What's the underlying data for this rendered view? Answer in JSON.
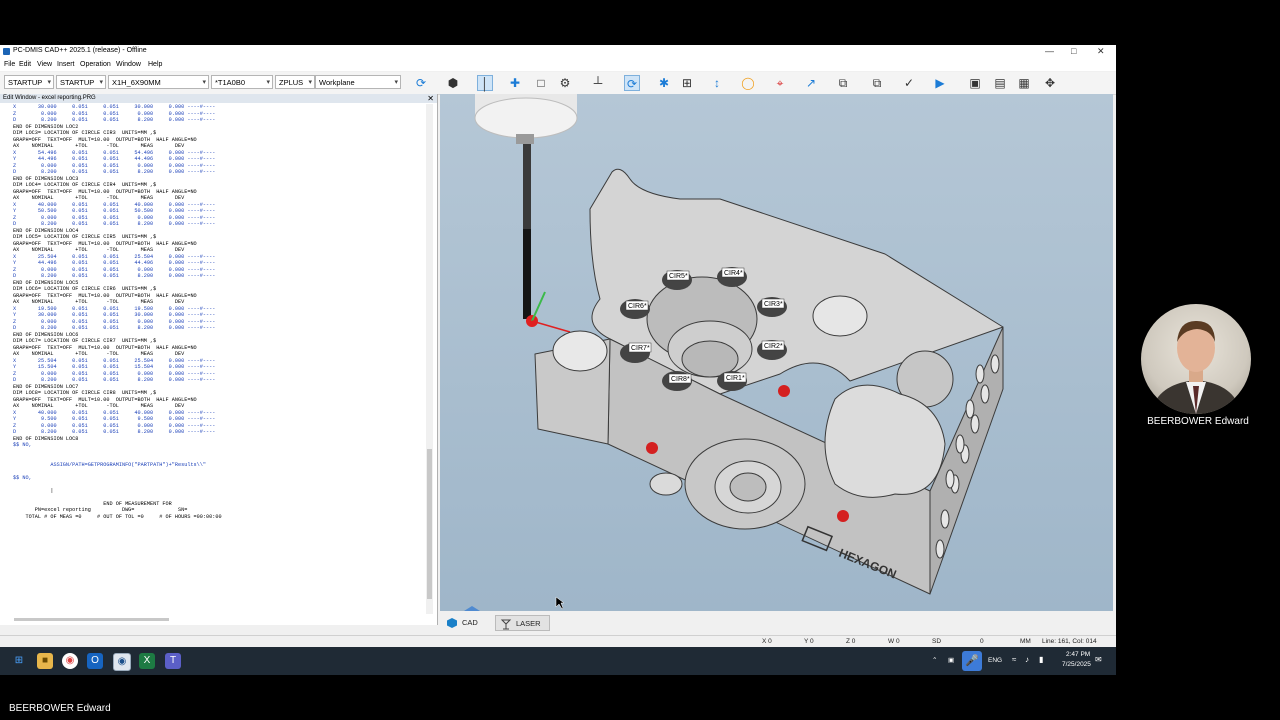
{
  "window": {
    "title": "PC-DMIS CAD++ 2025.1 (release) - Offline",
    "controls": [
      "—",
      "□",
      "✕"
    ]
  },
  "menu": [
    "File",
    "Edit",
    "View",
    "Insert",
    "Operation",
    "Window",
    "Help"
  ],
  "toolbar": {
    "combos": [
      {
        "name": "probe-file-combo",
        "value": "STARTUP"
      },
      {
        "name": "probe-alignment-combo",
        "value": "STARTUP"
      },
      {
        "name": "probe-model-combo",
        "value": "X1H_6X90MM"
      },
      {
        "name": "tip-combo",
        "value": "*T1A0B0"
      },
      {
        "name": "view-dir-combo",
        "value": "ZPLUS"
      },
      {
        "name": "workplane-combo",
        "value": "Workplane"
      }
    ]
  },
  "edit_window": {
    "title": "Edit Window - excel reporting.PRG",
    "close": "✕",
    "code_lines": [
      "X       30.000     0.051     0.051     30.000     0.000 ----#----",
      "Z        0.000     0.051     0.051      0.000     0.000 ----#----",
      "D        8.200     0.051     0.051      8.200     0.000 ----#----",
      "END OF DIMENSION LOC2",
      "DIM LOC3= LOCATION OF CIRCLE CIR3  UNITS=MM ,$",
      "GRAPH=OFF  TEXT=OFF  MULT=10.00  OUTPUT=BOTH  HALF ANGLE=NO",
      "AX    NOMINAL       +TOL      -TOL       MEAS       DEV",
      "X       54.496     0.051     0.051     54.496     0.000 ----#----",
      "Y       44.496     0.051     0.051     44.496     0.000 ----#----",
      "Z        0.000     0.051     0.051      0.000     0.000 ----#----",
      "D        8.200     0.051     0.051      8.200     0.000 ----#----",
      "END OF DIMENSION LOC3",
      "DIM LOC4= LOCATION OF CIRCLE CIR4  UNITS=MM ,$",
      "GRAPH=OFF  TEXT=OFF  MULT=10.00  OUTPUT=BOTH  HALF ANGLE=NO",
      "AX    NOMINAL       +TOL      -TOL       MEAS       DEV",
      "X       40.000     0.051     0.051     40.000     0.000 ----#----",
      "Y       50.500     0.051     0.051     50.500     0.000 ----#----",
      "Z        0.000     0.051     0.051      0.000     0.000 ----#----",
      "D        8.200     0.051     0.051      8.200     0.000 ----#----",
      "END OF DIMENSION LOC4",
      "DIM LOC5= LOCATION OF CIRCLE CIR5  UNITS=MM ,$",
      "GRAPH=OFF  TEXT=OFF  MULT=10.00  OUTPUT=BOTH  HALF ANGLE=NO",
      "AX    NOMINAL       +TOL      -TOL       MEAS       DEV",
      "X       25.504     0.051     0.051     25.504     0.000 ----#----",
      "Y       44.496     0.051     0.051     44.496     0.000 ----#----",
      "Z        0.000     0.051     0.051      0.000     0.000 ----#----",
      "D        8.200     0.051     0.051      8.200     0.000 ----#----",
      "END OF DIMENSION LOC5",
      "DIM LOC6= LOCATION OF CIRCLE CIR6  UNITS=MM ,$",
      "GRAPH=OFF  TEXT=OFF  MULT=10.00  OUTPUT=BOTH  HALF ANGLE=NO",
      "AX    NOMINAL       +TOL      -TOL       MEAS       DEV",
      "X       19.500     0.051     0.051     19.500     0.000 ----#----",
      "Y       30.000     0.051     0.051     30.000     0.000 ----#----",
      "Z        0.000     0.051     0.051      0.000     0.000 ----#----",
      "D        8.200     0.051     0.051      8.200     0.000 ----#----",
      "END OF DIMENSION LOC6",
      "DIM LOC7= LOCATION OF CIRCLE CIR7  UNITS=MM ,$",
      "GRAPH=OFF  TEXT=OFF  MULT=10.00  OUTPUT=BOTH  HALF ANGLE=NO",
      "AX    NOMINAL       +TOL      -TOL       MEAS       DEV",
      "X       25.504     0.051     0.051     25.504     0.000 ----#----",
      "Y       15.504     0.051     0.051     15.504     0.000 ----#----",
      "Z        0.000     0.051     0.051      0.000     0.000 ----#----",
      "D        8.200     0.051     0.051      8.200     0.000 ----#----",
      "END OF DIMENSION LOC7",
      "DIM LOC8= LOCATION OF CIRCLE CIR8  UNITS=MM ,$",
      "GRAPH=OFF  TEXT=OFF  MULT=10.00  OUTPUT=BOTH  HALF ANGLE=NO",
      "AX    NOMINAL       +TOL      -TOL       MEAS       DEV",
      "X       40.000     0.051     0.051     40.000     0.000 ----#----",
      "Y        9.500     0.051     0.051      9.500     0.000 ----#----",
      "Z        0.000     0.051     0.051      0.000     0.000 ----#----",
      "D        8.200     0.051     0.051      8.200     0.000 ----#----",
      "END OF DIMENSION LOC8",
      "$$ NO,",
      "",
      "",
      "            ASSIGN/PATH=GETPROGRAMINFO(\"PARTPATH\")+\"Results\\\\\"",
      "",
      "$$ NO,",
      "",
      "            |",
      "",
      "                             END OF MEASUREMENT FOR",
      "       PN=excel reporting          DWG=              SN=",
      "    TOTAL # OF MEAS =0     # OUT OF TOL =0     # OF HOURS =00:00:00"
    ]
  },
  "cad_labels": [
    "CIR5*",
    "CIR4*",
    "CIR6*",
    "CIR3*",
    "CIR7*",
    "CIR2*",
    "CIR8*",
    "CIR1*"
  ],
  "cad_logo": "HEXAGON",
  "tabs": [
    {
      "label": "CAD"
    },
    {
      "label": "LASER"
    }
  ],
  "status": {
    "x": "X 0",
    "y": "Y 0",
    "z": "Z 0",
    "w": "W 0",
    "sd": "SD",
    "sd_value": "0",
    "units": "MM",
    "line": "Line: 161, Col: 014"
  },
  "taskbar": {
    "lang": "ENG",
    "time": "2:47 PM",
    "date": "7/25/2025"
  },
  "webcam": {
    "name": "BEERBOWER Edward"
  },
  "participant": {
    "name": "BEERBOWER Edward"
  },
  "colors": {
    "accent": "#1c7cd6",
    "cad_background": "#a9bfd0",
    "taskbar": "#1f2a35",
    "code_blue": "#1a3fb8"
  }
}
